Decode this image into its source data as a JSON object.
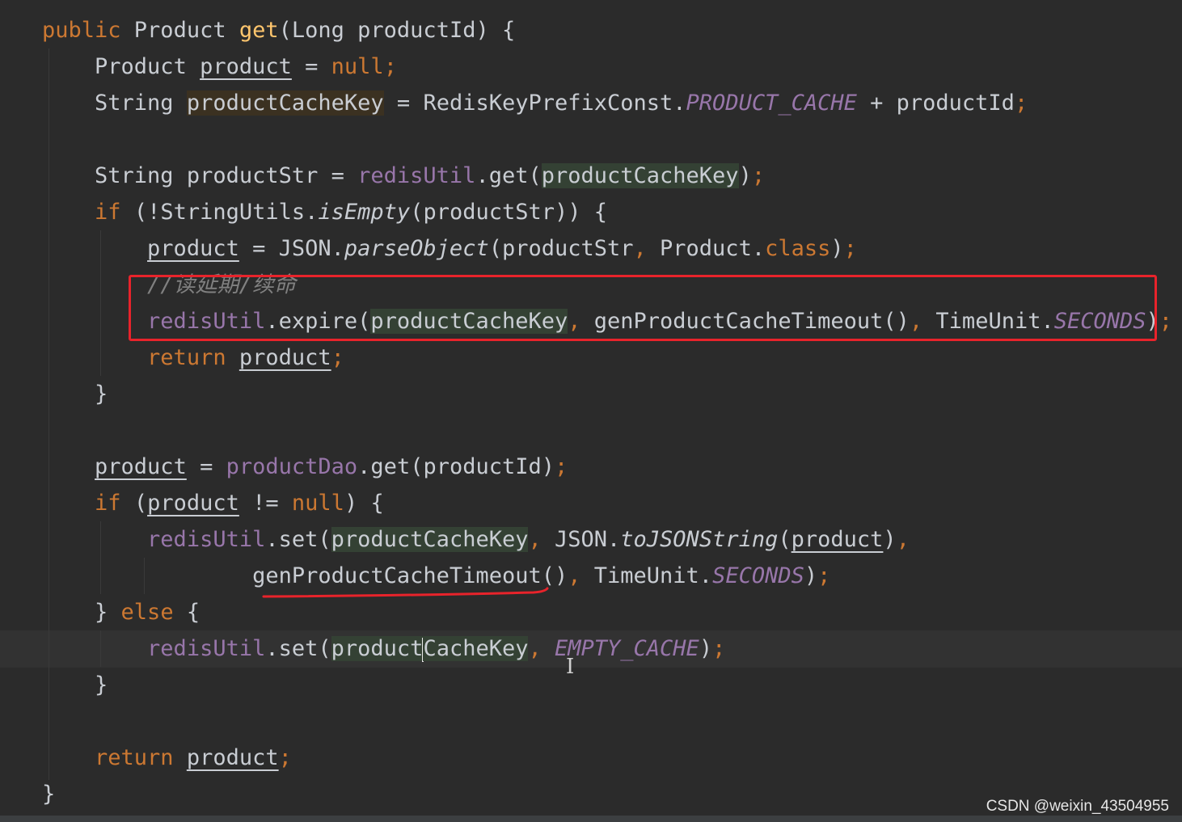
{
  "editor": {
    "watermark": "CSDN @weixin_43504955",
    "colors": {
      "background": "#2b2b2b",
      "keyword": "#cc7832",
      "method_declaration": "#ffc66d",
      "field": "#9876aa",
      "plain": "#c9cdd3",
      "comment": "#808080",
      "annotation_red": "#e8232b"
    },
    "lines": [
      [
        {
          "t": "public ",
          "c": "kw"
        },
        {
          "t": "Product "
        },
        {
          "t": "get",
          "c": "fn"
        },
        {
          "t": "(Long productId) {"
        }
      ],
      [
        {
          "t": "    "
        },
        {
          "t": "Product "
        },
        {
          "t": "product",
          "c": "ul"
        },
        {
          "t": " = "
        },
        {
          "t": "null",
          "c": "kw"
        },
        {
          "t": ";",
          "c": "punc"
        }
      ],
      [
        {
          "t": "    "
        },
        {
          "t": "String "
        },
        {
          "t": "productCacheKey",
          "c": "hl-brown"
        },
        {
          "t": " = RedisKeyPrefixConst."
        },
        {
          "t": "PRODUCT_CACHE",
          "c": "field-i"
        },
        {
          "t": " + productId"
        },
        {
          "t": ";",
          "c": "punc"
        }
      ],
      [],
      [
        {
          "t": "    "
        },
        {
          "t": "String productStr = "
        },
        {
          "t": "redisUtil",
          "c": "field"
        },
        {
          "t": ".get("
        },
        {
          "t": "productCacheKey",
          "c": "hl-green"
        },
        {
          "t": ")"
        },
        {
          "t": ";",
          "c": "punc"
        }
      ],
      [
        {
          "t": "    "
        },
        {
          "t": "if ",
          "c": "kw"
        },
        {
          "t": "(!StringUtils."
        },
        {
          "t": "isEmpty",
          "c": "static-i"
        },
        {
          "t": "(productStr)) {"
        }
      ],
      [
        {
          "t": "        "
        },
        {
          "t": "product",
          "c": "ul"
        },
        {
          "t": " = JSON."
        },
        {
          "t": "parseObject",
          "c": "static-i"
        },
        {
          "t": "(productStr"
        },
        {
          "t": ", ",
          "c": "punc"
        },
        {
          "t": "Product."
        },
        {
          "t": "class",
          "c": "kw"
        },
        {
          "t": ")"
        },
        {
          "t": ";",
          "c": "punc"
        }
      ],
      [
        {
          "t": "        "
        },
        {
          "t": "//读延期/续命",
          "c": "comment"
        }
      ],
      [
        {
          "t": "        "
        },
        {
          "t": "redisUtil",
          "c": "field"
        },
        {
          "t": ".expire("
        },
        {
          "t": "productCacheKey",
          "c": "hl-green"
        },
        {
          "t": ", ",
          "c": "punc"
        },
        {
          "t": "genProductCacheTimeout()"
        },
        {
          "t": ", ",
          "c": "punc"
        },
        {
          "t": "TimeUnit."
        },
        {
          "t": "SECONDS",
          "c": "field-i"
        },
        {
          "t": ")"
        },
        {
          "t": ";",
          "c": "punc"
        }
      ],
      [
        {
          "t": "        "
        },
        {
          "t": "return ",
          "c": "kw"
        },
        {
          "t": "product",
          "c": "ul"
        },
        {
          "t": ";",
          "c": "punc"
        }
      ],
      [
        {
          "t": "    "
        },
        {
          "t": "}"
        }
      ],
      [],
      [
        {
          "t": "    "
        },
        {
          "t": "product",
          "c": "ul"
        },
        {
          "t": " = "
        },
        {
          "t": "productDao",
          "c": "field"
        },
        {
          "t": ".get(productId)"
        },
        {
          "t": ";",
          "c": "punc"
        }
      ],
      [
        {
          "t": "    "
        },
        {
          "t": "if ",
          "c": "kw"
        },
        {
          "t": "("
        },
        {
          "t": "product",
          "c": "ul"
        },
        {
          "t": " != "
        },
        {
          "t": "null",
          "c": "kw"
        },
        {
          "t": ") {"
        }
      ],
      [
        {
          "t": "        "
        },
        {
          "t": "redisUtil",
          "c": "field"
        },
        {
          "t": ".set("
        },
        {
          "t": "productCacheKey",
          "c": "hl-green"
        },
        {
          "t": ", ",
          "c": "punc"
        },
        {
          "t": "JSON."
        },
        {
          "t": "toJSONString",
          "c": "static-i"
        },
        {
          "t": "("
        },
        {
          "t": "product",
          "c": "ul"
        },
        {
          "t": ")"
        },
        {
          "t": ",",
          "c": "punc"
        }
      ],
      [
        {
          "t": "                "
        },
        {
          "t": "genProductCacheTimeout()"
        },
        {
          "t": ", ",
          "c": "punc"
        },
        {
          "t": "TimeUnit."
        },
        {
          "t": "SECONDS",
          "c": "field-i"
        },
        {
          "t": ")"
        },
        {
          "t": ";",
          "c": "punc"
        }
      ],
      [
        {
          "t": "    "
        },
        {
          "t": "} "
        },
        {
          "t": "else ",
          "c": "kw"
        },
        {
          "t": "{"
        }
      ],
      [
        {
          "t": "        "
        },
        {
          "t": "redisUtil",
          "c": "field"
        },
        {
          "t": ".set("
        },
        {
          "t": "product",
          "c": "hl-green"
        },
        {
          "caret": true
        },
        {
          "t": "CacheKey",
          "c": "hl-green"
        },
        {
          "t": ", ",
          "c": "punc"
        },
        {
          "t": "EMPTY_CACHE",
          "c": "field-i"
        },
        {
          "t": ")"
        },
        {
          "t": ";",
          "c": "punc"
        }
      ],
      [
        {
          "t": "    "
        },
        {
          "t": "}"
        }
      ],
      [],
      [
        {
          "t": "    "
        },
        {
          "t": "return ",
          "c": "kw"
        },
        {
          "t": "product",
          "c": "ul"
        },
        {
          "t": ";",
          "c": "punc"
        }
      ],
      [
        {
          "t": "}"
        }
      ]
    ]
  }
}
